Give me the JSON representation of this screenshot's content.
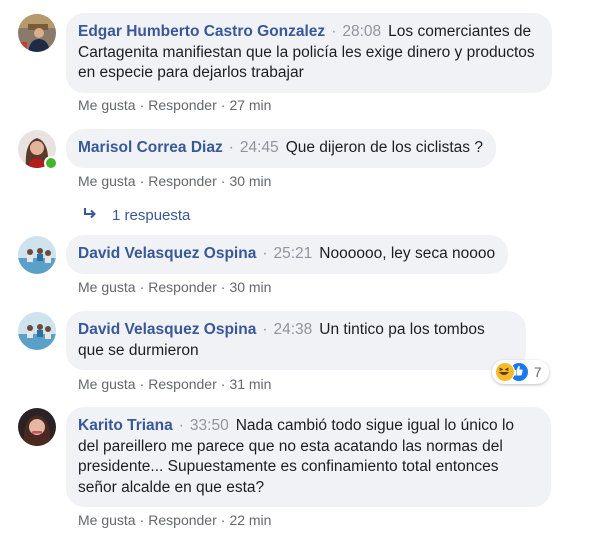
{
  "action_labels": {
    "like": "Me gusta",
    "reply": "Responder",
    "dot": "·"
  },
  "comments": [
    {
      "author": "Edgar Humberto Castro Gonzalez",
      "time": "28:08",
      "text": "Los comerciantes de Cartagenita manifiestan que la policía les exige dinero y productos en especie para dejarlos trabajar",
      "age": "27 min"
    },
    {
      "author": "Marisol Correa Diaz",
      "time": "24:45",
      "text": "Que dijeron de los ciclistas ?",
      "age": "30 min",
      "online": true,
      "replies_label": "1 respuesta"
    },
    {
      "author": "David Velasquez Ospina",
      "time": "25:21",
      "text": "Noooooo, ley seca noooo",
      "age": "30 min"
    },
    {
      "author": "David Velasquez Ospina",
      "time": "24:38",
      "text": "Un tintico pa los tombos que se durmieron",
      "age": "31 min",
      "reactions": {
        "icons": [
          "haha-icon",
          "like-icon"
        ],
        "count": "7"
      }
    },
    {
      "author": "Karito Triana",
      "time": "33:50",
      "text": "Nada cambió todo sigue igual lo único lo del pareillero me parece que no esta acatando las normas del presidente... Supuestamente es confinamiento total entonces señor alcalde en que esta?",
      "age": "22 min"
    }
  ],
  "colors": {
    "author": "#385898",
    "bubble": "#f0f2f5",
    "muted": "#65676b",
    "online": "#42b72a",
    "like": "#1877f2",
    "haha": "#f7b928"
  }
}
